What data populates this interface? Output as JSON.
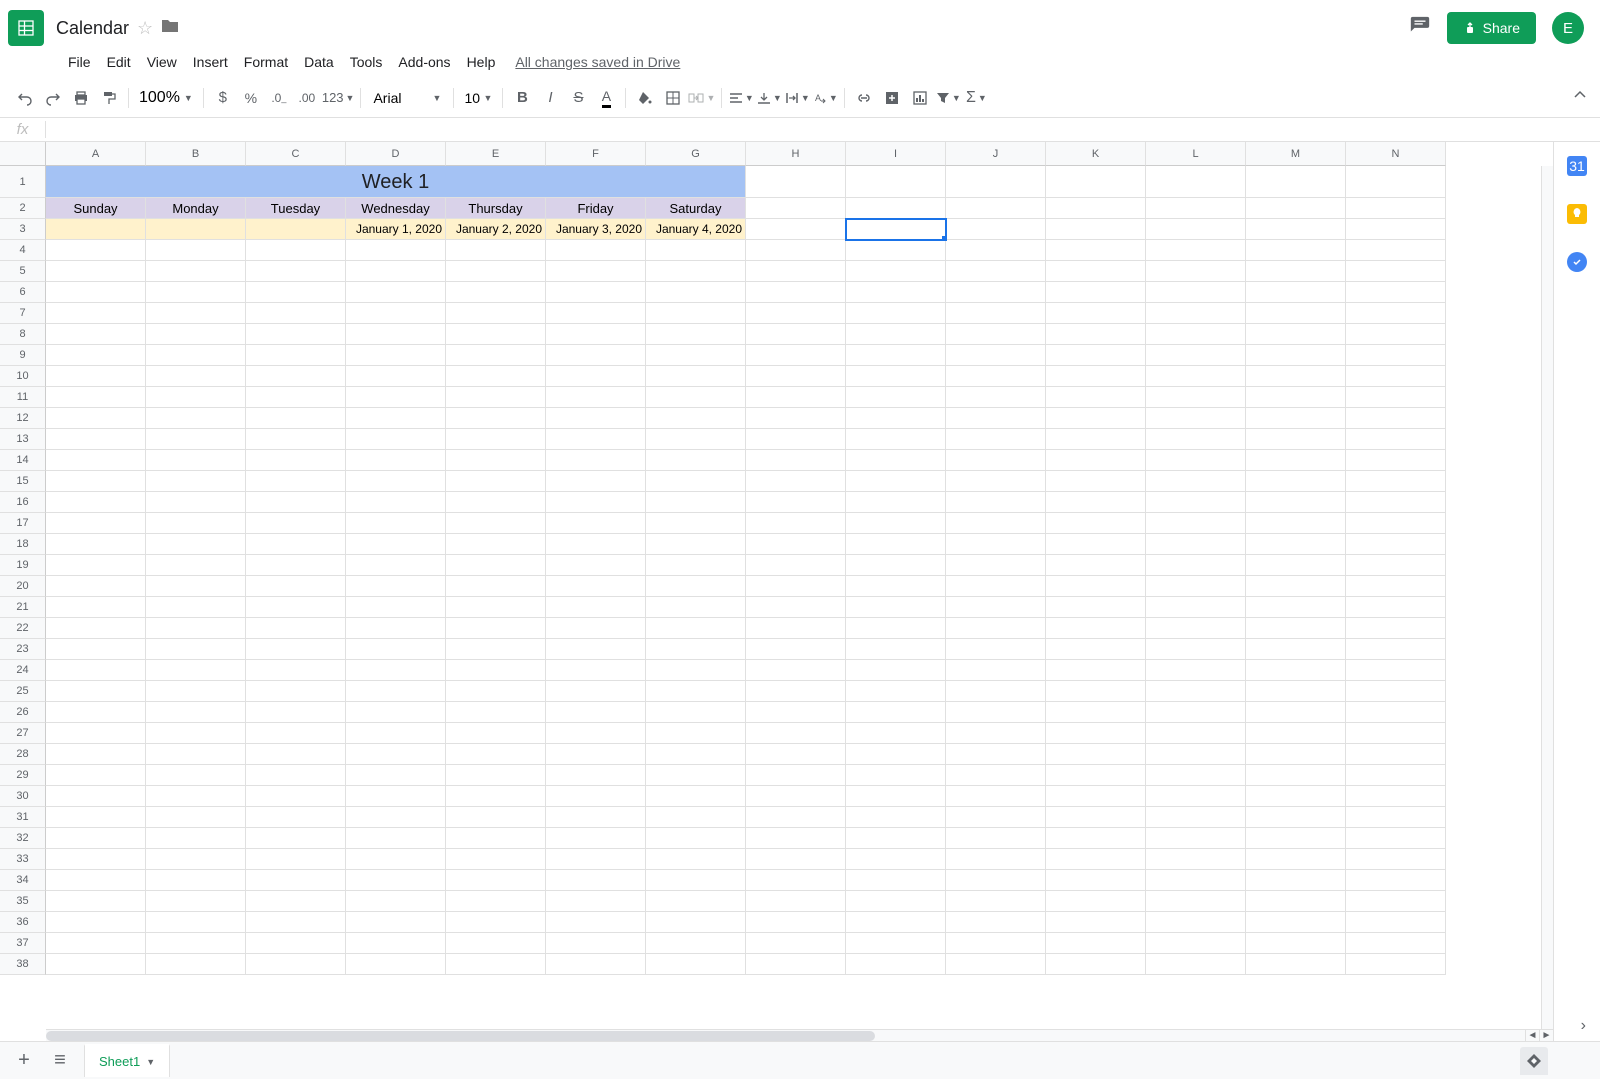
{
  "doc": {
    "title": "Calendar",
    "avatar_letter": "E"
  },
  "menus": [
    "File",
    "Edit",
    "View",
    "Insert",
    "Format",
    "Data",
    "Tools",
    "Add-ons",
    "Help"
  ],
  "save_status": "All changes saved in Drive",
  "share_label": "Share",
  "toolbar": {
    "zoom": "100%",
    "font": "Arial",
    "font_size": "10",
    "format_123": "123"
  },
  "formula_bar": {
    "label": "fx",
    "value": ""
  },
  "columns": [
    "A",
    "B",
    "C",
    "D",
    "E",
    "F",
    "G",
    "H",
    "I",
    "J",
    "K",
    "L",
    "M",
    "N"
  ],
  "row_count": 38,
  "sheet": {
    "week_title": "Week 1",
    "days": [
      "Sunday",
      "Monday",
      "Tuesday",
      "Wednesday",
      "Thursday",
      "Friday",
      "Saturday"
    ],
    "dates": [
      "",
      "",
      "",
      "January 1, 2020",
      "January 2, 2020",
      "January 3, 2020",
      "January 4, 2020"
    ]
  },
  "selected_cell": "I3",
  "tabs": {
    "sheet1": "Sheet1"
  }
}
